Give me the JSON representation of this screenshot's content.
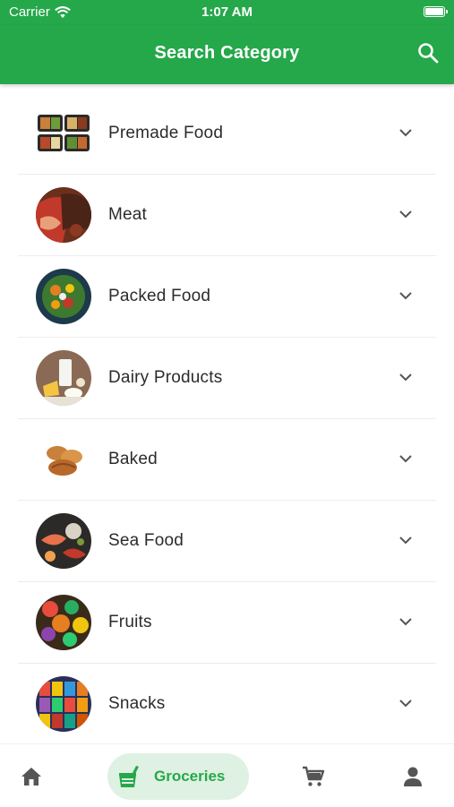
{
  "status_bar": {
    "carrier": "Carrier",
    "time": "1:07 AM"
  },
  "app_bar": {
    "title": "Search Category"
  },
  "categories": [
    {
      "label": "Premade Food"
    },
    {
      "label": "Meat"
    },
    {
      "label": "Packed Food"
    },
    {
      "label": "Dairy Products"
    },
    {
      "label": "Baked"
    },
    {
      "label": "Sea Food"
    },
    {
      "label": "Fruits"
    },
    {
      "label": "Snacks"
    }
  ],
  "bottom_nav": {
    "active_label": "Groceries"
  },
  "colors": {
    "primary": "#25a84a",
    "pill_bg": "#dff1e2"
  },
  "icons": [
    "wifi-icon",
    "battery-icon",
    "search-icon",
    "chevron-down-icon",
    "home-icon",
    "groceries-icon",
    "cart-icon",
    "user-icon"
  ]
}
